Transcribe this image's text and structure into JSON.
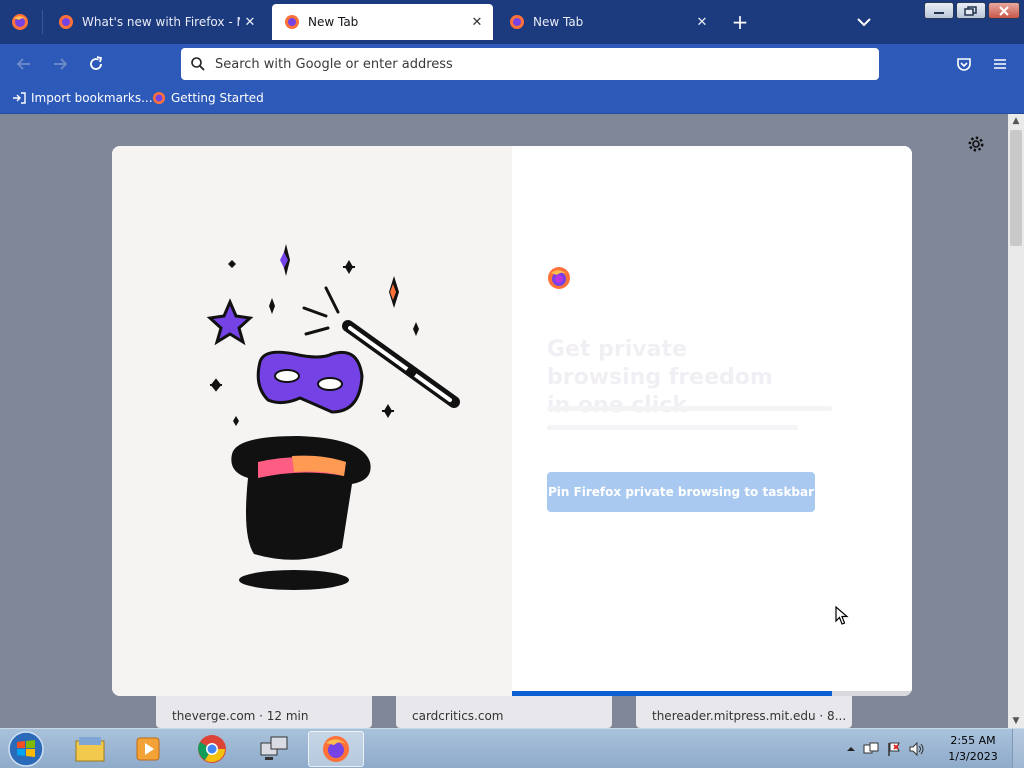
{
  "tabs": [
    {
      "title": "What's new with Firefox - More",
      "active": false
    },
    {
      "title": "New Tab",
      "active": true
    },
    {
      "title": "New Tab",
      "active": false
    }
  ],
  "tab_close_glyph": "✕",
  "new_tab_glyph": "+",
  "urlbar": {
    "placeholder": "Search with Google or enter address"
  },
  "bookmarks": [
    {
      "label": "Import bookmarks...",
      "icon": "import-icon"
    },
    {
      "label": "Getting Started",
      "icon": "firefox-icon"
    }
  ],
  "modal": {
    "headline": "Get private browsing freedom in one click",
    "button_label": "Pin Firefox private browsing to taskbar",
    "progress": 0.8
  },
  "top_sites": [
    "theverge.com · 12 min",
    "cardcritics.com",
    "thereader.mitpress.mit.edu · 8..."
  ],
  "taskbar": {
    "time": "2:55 AM",
    "date": "1/3/2023"
  },
  "colors": {
    "tabstrip": "#1c3a7e",
    "toolbar": "#2d59b8",
    "backdrop": "#7f8798",
    "button": "#a9c9f1",
    "progress": "#0a5fd1"
  }
}
